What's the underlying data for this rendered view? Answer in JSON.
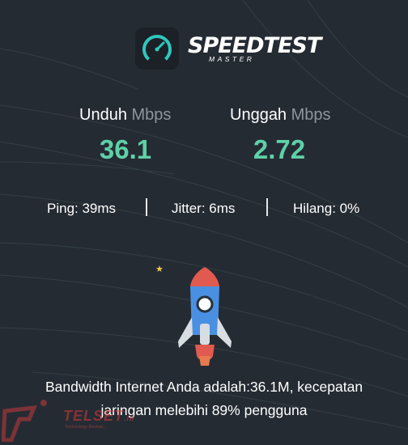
{
  "app": {
    "brand_name": "SPEEDTEST",
    "brand_subtitle": "MASTER",
    "logo_icon": "speedometer-icon",
    "accent_color": "#5ed0a7",
    "background_color": "#252b33"
  },
  "download": {
    "label": "Unduh",
    "unit": "Mbps",
    "value": "36.1"
  },
  "upload": {
    "label": "Unggah",
    "unit": "Mbps",
    "value": "2.72"
  },
  "stats": {
    "ping": "Ping: 39ms",
    "jitter": "Jitter: 6ms",
    "loss": "Hilang: 0%"
  },
  "illustration": {
    "rocket_icon": "rocket-icon",
    "star_icon": "star-icon"
  },
  "message": {
    "line1": "Bandwidth Internet Anda adalah:36.1M, kecepatan",
    "line2": "jaringan melebihi 89% pengguna"
  },
  "watermark": {
    "text": "TELSET",
    "suffix": ".id",
    "tagline": "Technology Review..."
  }
}
